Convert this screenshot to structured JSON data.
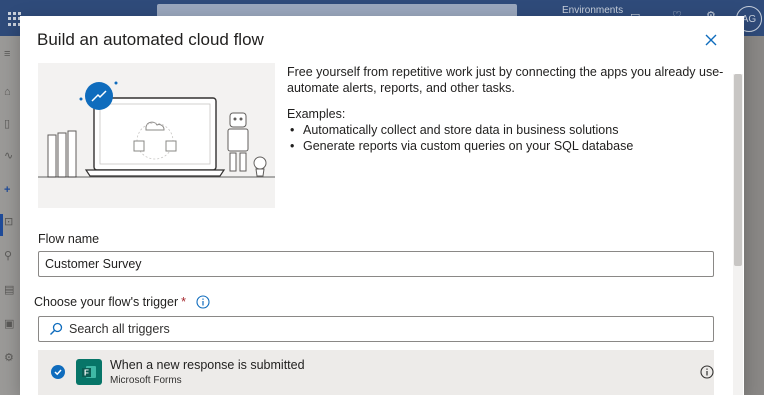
{
  "app_header": {
    "environments_label": "Environments",
    "avatar_initials": "AG"
  },
  "dialog": {
    "title": "Build an automated cloud flow",
    "description": "Free yourself from repetitive work just by connecting the apps you already use- automate alerts, reports, and other tasks.",
    "examples_heading": "Examples:",
    "examples": [
      "Automatically collect and store data in business solutions",
      "Generate reports via custom queries on your SQL database"
    ],
    "flow_name_label": "Flow name",
    "flow_name_value": "Customer Survey",
    "trigger_label": "Choose your flow's trigger",
    "required_mark": "*",
    "search_placeholder": "Search all triggers",
    "selected_trigger": {
      "title": "When a new response is submitted",
      "connector": "Microsoft Forms",
      "icon": "microsoft-forms-icon"
    }
  },
  "colors": {
    "accent": "#0f6cbd",
    "forms_green": "#077568",
    "required": "#a4262c"
  }
}
